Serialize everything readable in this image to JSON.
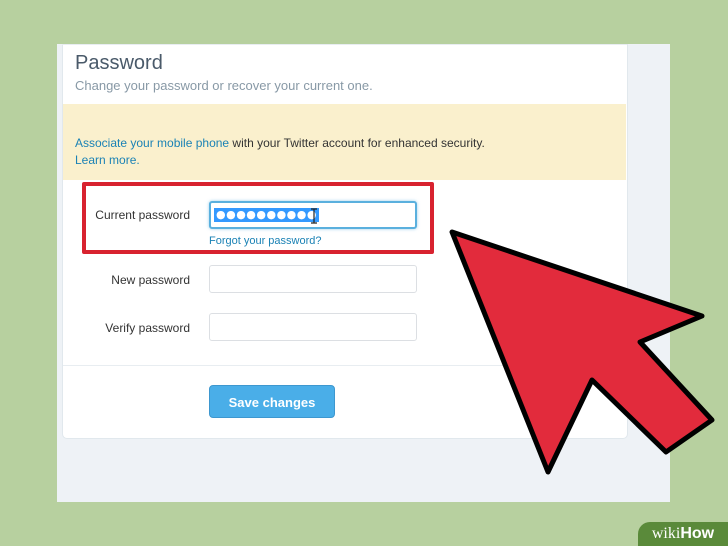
{
  "header": {
    "title": "Password",
    "subtitle": "Change your password or recover your current one."
  },
  "notice": {
    "link_text": "Associate your mobile phone",
    "text": " with your Twitter account for enhanced security.",
    "learn_more": "Learn more."
  },
  "form": {
    "current_password_label": "Current password",
    "current_password_value": "●●●●●●●●●●",
    "forgot_link": "Forgot your password?",
    "new_password_label": "New password",
    "verify_password_label": "Verify password",
    "save_button": "Save changes"
  },
  "colors": {
    "highlight": "#d8222f",
    "arrow": "#e22b3c",
    "accent": "#4aaee8"
  },
  "watermark": {
    "prefix": "wiki",
    "suffix": "How"
  }
}
